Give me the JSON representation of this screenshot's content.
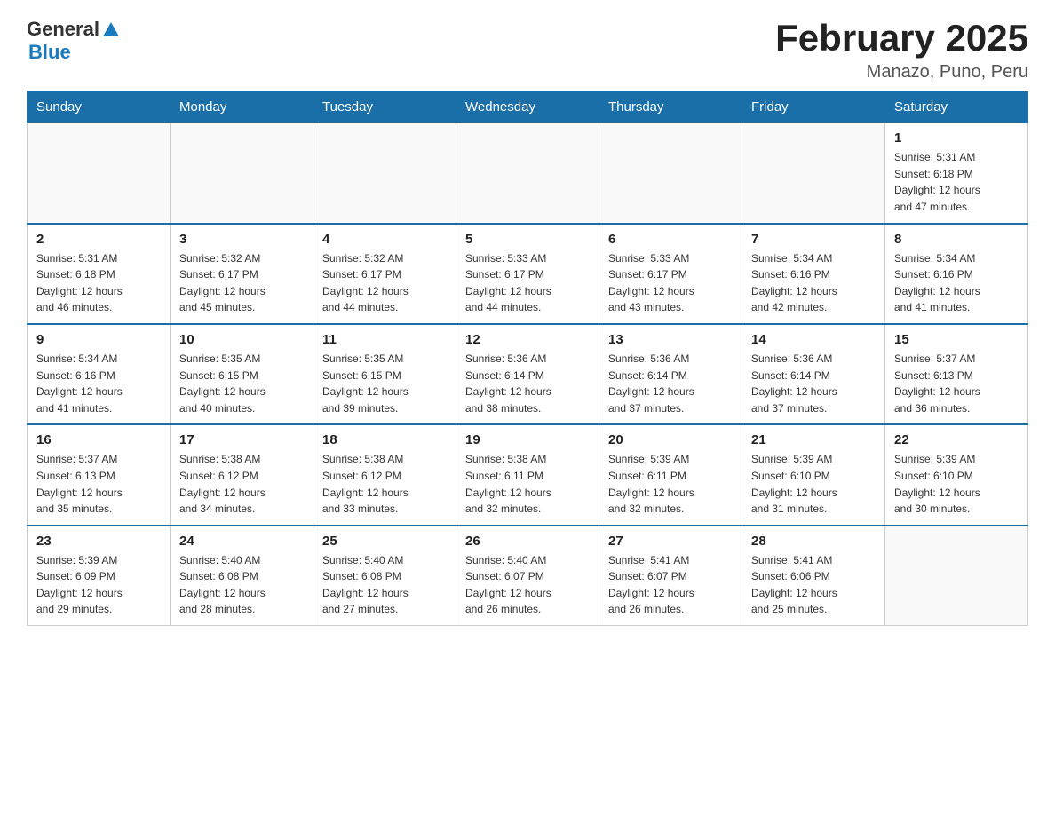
{
  "header": {
    "logo": {
      "general": "General",
      "blue": "Blue",
      "arrow": "▲"
    },
    "title": "February 2025",
    "location": "Manazo, Puno, Peru"
  },
  "weekdays": [
    "Sunday",
    "Monday",
    "Tuesday",
    "Wednesday",
    "Thursday",
    "Friday",
    "Saturday"
  ],
  "weeks": [
    [
      {
        "day": "",
        "info": ""
      },
      {
        "day": "",
        "info": ""
      },
      {
        "day": "",
        "info": ""
      },
      {
        "day": "",
        "info": ""
      },
      {
        "day": "",
        "info": ""
      },
      {
        "day": "",
        "info": ""
      },
      {
        "day": "1",
        "info": "Sunrise: 5:31 AM\nSunset: 6:18 PM\nDaylight: 12 hours\nand 47 minutes."
      }
    ],
    [
      {
        "day": "2",
        "info": "Sunrise: 5:31 AM\nSunset: 6:18 PM\nDaylight: 12 hours\nand 46 minutes."
      },
      {
        "day": "3",
        "info": "Sunrise: 5:32 AM\nSunset: 6:17 PM\nDaylight: 12 hours\nand 45 minutes."
      },
      {
        "day": "4",
        "info": "Sunrise: 5:32 AM\nSunset: 6:17 PM\nDaylight: 12 hours\nand 44 minutes."
      },
      {
        "day": "5",
        "info": "Sunrise: 5:33 AM\nSunset: 6:17 PM\nDaylight: 12 hours\nand 44 minutes."
      },
      {
        "day": "6",
        "info": "Sunrise: 5:33 AM\nSunset: 6:17 PM\nDaylight: 12 hours\nand 43 minutes."
      },
      {
        "day": "7",
        "info": "Sunrise: 5:34 AM\nSunset: 6:16 PM\nDaylight: 12 hours\nand 42 minutes."
      },
      {
        "day": "8",
        "info": "Sunrise: 5:34 AM\nSunset: 6:16 PM\nDaylight: 12 hours\nand 41 minutes."
      }
    ],
    [
      {
        "day": "9",
        "info": "Sunrise: 5:34 AM\nSunset: 6:16 PM\nDaylight: 12 hours\nand 41 minutes."
      },
      {
        "day": "10",
        "info": "Sunrise: 5:35 AM\nSunset: 6:15 PM\nDaylight: 12 hours\nand 40 minutes."
      },
      {
        "day": "11",
        "info": "Sunrise: 5:35 AM\nSunset: 6:15 PM\nDaylight: 12 hours\nand 39 minutes."
      },
      {
        "day": "12",
        "info": "Sunrise: 5:36 AM\nSunset: 6:14 PM\nDaylight: 12 hours\nand 38 minutes."
      },
      {
        "day": "13",
        "info": "Sunrise: 5:36 AM\nSunset: 6:14 PM\nDaylight: 12 hours\nand 37 minutes."
      },
      {
        "day": "14",
        "info": "Sunrise: 5:36 AM\nSunset: 6:14 PM\nDaylight: 12 hours\nand 37 minutes."
      },
      {
        "day": "15",
        "info": "Sunrise: 5:37 AM\nSunset: 6:13 PM\nDaylight: 12 hours\nand 36 minutes."
      }
    ],
    [
      {
        "day": "16",
        "info": "Sunrise: 5:37 AM\nSunset: 6:13 PM\nDaylight: 12 hours\nand 35 minutes."
      },
      {
        "day": "17",
        "info": "Sunrise: 5:38 AM\nSunset: 6:12 PM\nDaylight: 12 hours\nand 34 minutes."
      },
      {
        "day": "18",
        "info": "Sunrise: 5:38 AM\nSunset: 6:12 PM\nDaylight: 12 hours\nand 33 minutes."
      },
      {
        "day": "19",
        "info": "Sunrise: 5:38 AM\nSunset: 6:11 PM\nDaylight: 12 hours\nand 32 minutes."
      },
      {
        "day": "20",
        "info": "Sunrise: 5:39 AM\nSunset: 6:11 PM\nDaylight: 12 hours\nand 32 minutes."
      },
      {
        "day": "21",
        "info": "Sunrise: 5:39 AM\nSunset: 6:10 PM\nDaylight: 12 hours\nand 31 minutes."
      },
      {
        "day": "22",
        "info": "Sunrise: 5:39 AM\nSunset: 6:10 PM\nDaylight: 12 hours\nand 30 minutes."
      }
    ],
    [
      {
        "day": "23",
        "info": "Sunrise: 5:39 AM\nSunset: 6:09 PM\nDaylight: 12 hours\nand 29 minutes."
      },
      {
        "day": "24",
        "info": "Sunrise: 5:40 AM\nSunset: 6:08 PM\nDaylight: 12 hours\nand 28 minutes."
      },
      {
        "day": "25",
        "info": "Sunrise: 5:40 AM\nSunset: 6:08 PM\nDaylight: 12 hours\nand 27 minutes."
      },
      {
        "day": "26",
        "info": "Sunrise: 5:40 AM\nSunset: 6:07 PM\nDaylight: 12 hours\nand 26 minutes."
      },
      {
        "day": "27",
        "info": "Sunrise: 5:41 AM\nSunset: 6:07 PM\nDaylight: 12 hours\nand 26 minutes."
      },
      {
        "day": "28",
        "info": "Sunrise: 5:41 AM\nSunset: 6:06 PM\nDaylight: 12 hours\nand 25 minutes."
      },
      {
        "day": "",
        "info": ""
      }
    ]
  ]
}
